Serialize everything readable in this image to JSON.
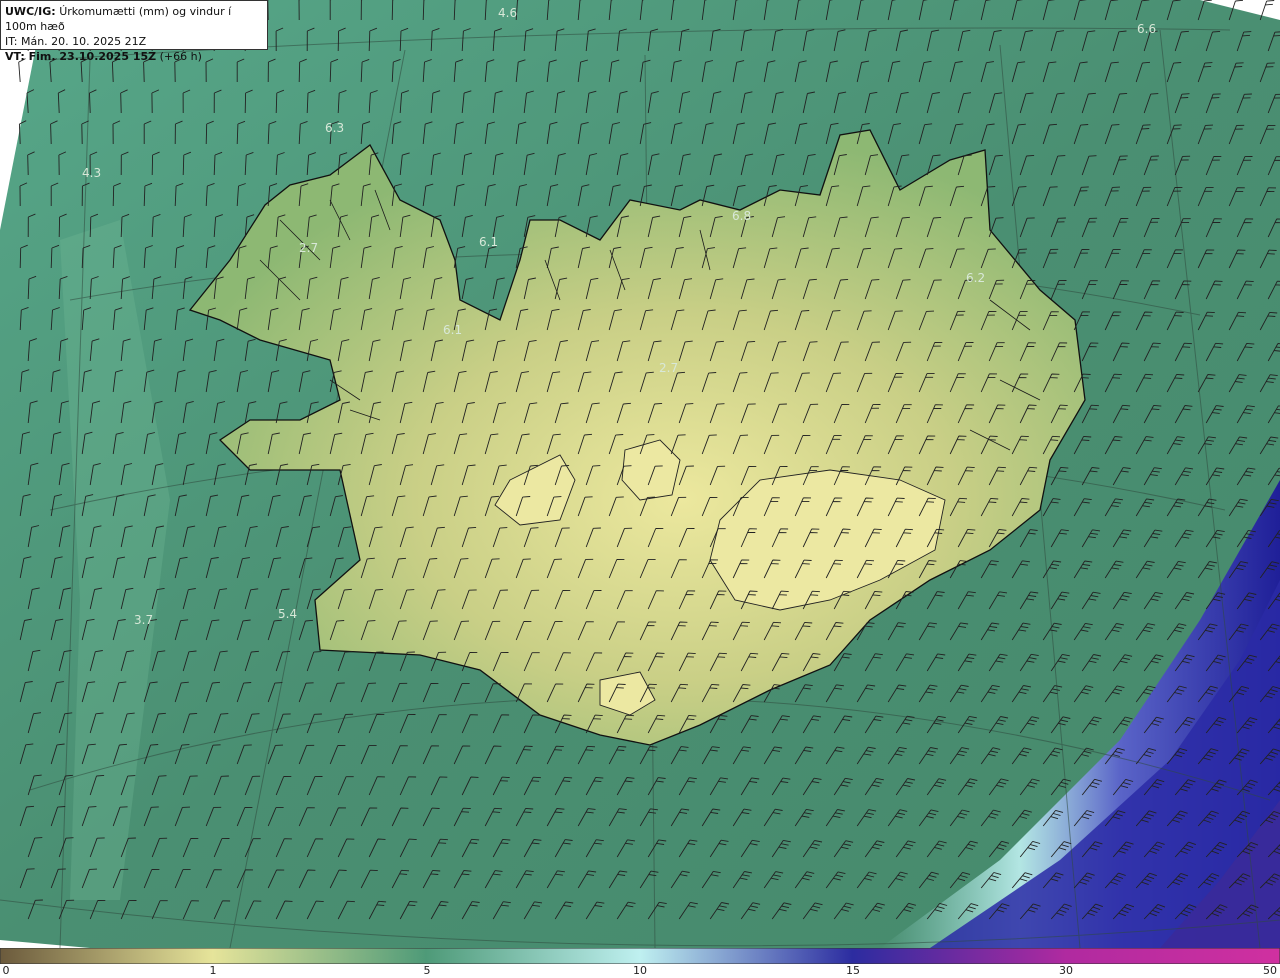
{
  "header": {
    "model_code": "UWC/IG:",
    "title": "Úrkomumætti (mm) og vindur í 100m hæð",
    "init_time": "IT: Mán. 20. 10. 2025 21Z",
    "valid_prefix": "VT: Fim. 23.10.2025 15Z",
    "lead_time": "(+66 h)"
  },
  "map_labels": [
    "4.6",
    "6.6",
    "6.3",
    "4.3",
    "2.7",
    "6.1",
    "6.8",
    "6.2",
    "6.1",
    "2.7",
    "3.7",
    "5.4"
  ],
  "colorbar": {
    "ticks": [
      "0",
      "1",
      "5",
      "10",
      "15",
      "30",
      "50"
    ],
    "colors": [
      "#6b5a3c",
      "#b9a070",
      "#e6e49a",
      "#4e9a78",
      "#bff0f0",
      "#2c2ca0",
      "#b02aa0",
      "#d030a0"
    ]
  },
  "colors": {
    "sea": "#4a8f72",
    "land_low": "#7fae6a",
    "land_high": "#e9e59a",
    "precip_heavy": "#2a2aa6",
    "precip_light": "#bfeff0"
  }
}
